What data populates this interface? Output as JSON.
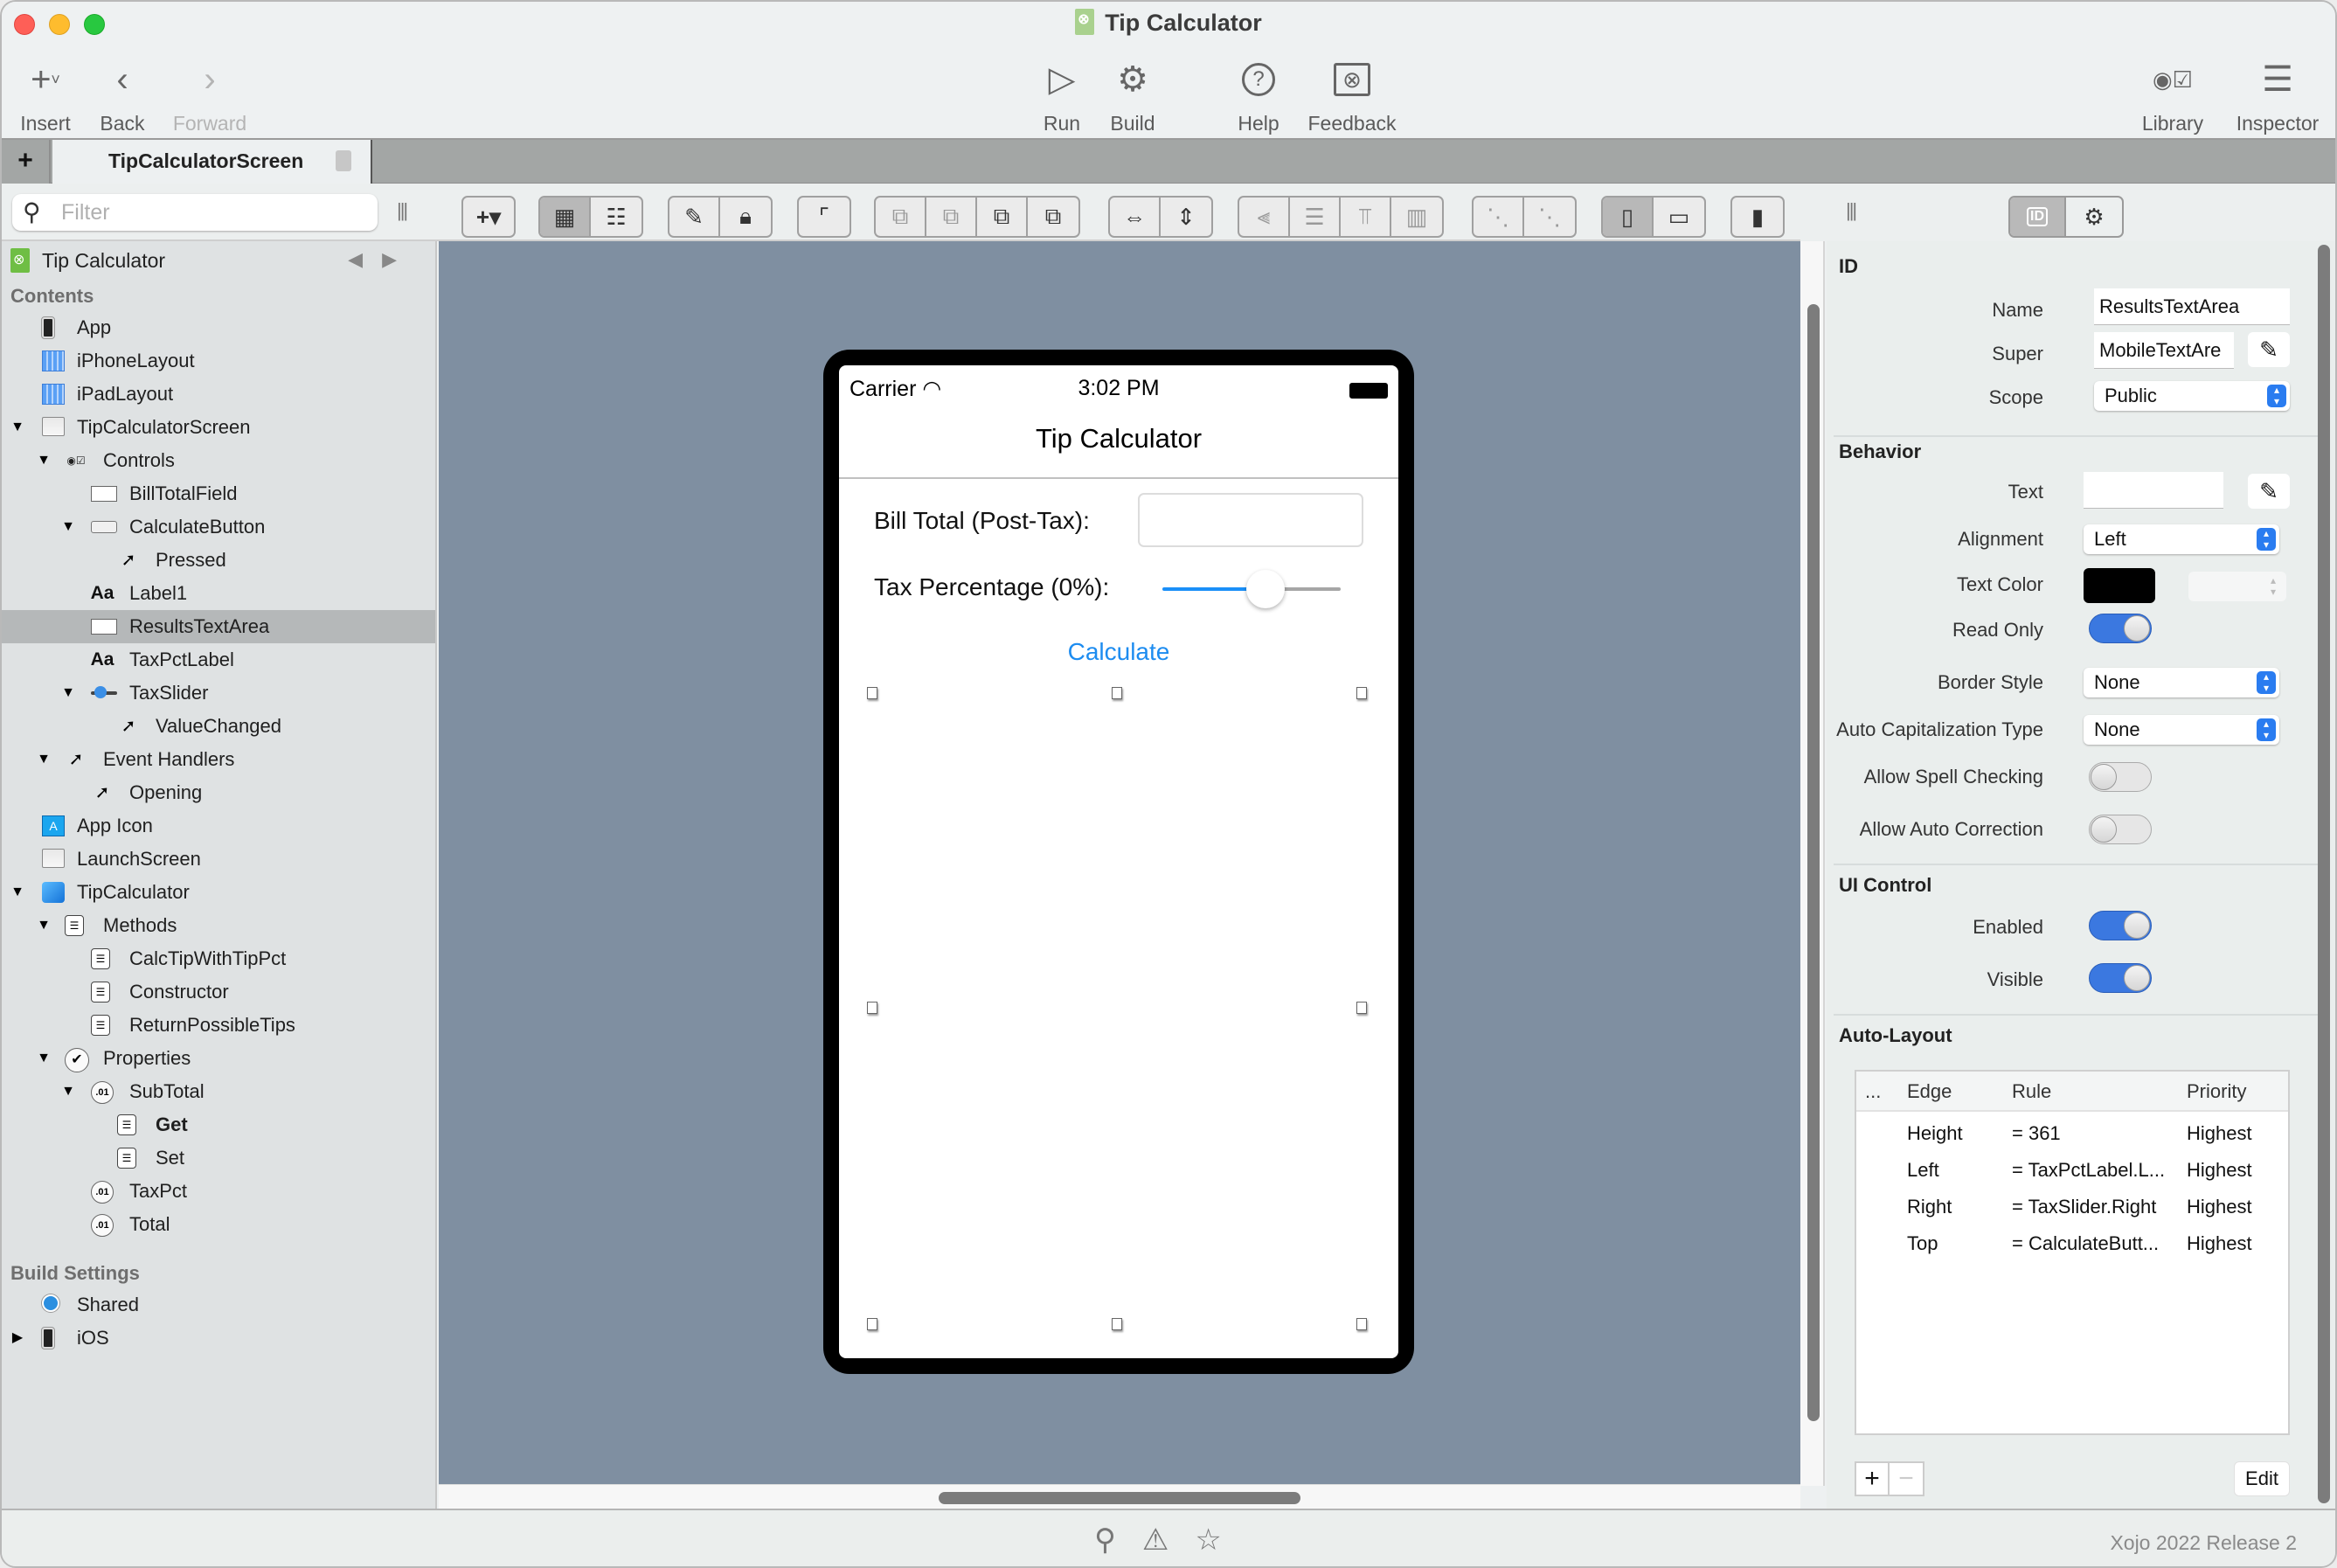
{
  "window": {
    "title": "Tip Calculator",
    "toolbar": {
      "insert": "Insert",
      "back": "Back",
      "forward": "Forward",
      "run": "Run",
      "build": "Build",
      "help": "Help",
      "feedback": "Feedback",
      "library": "Library",
      "inspector": "Inspector"
    }
  },
  "tabs": [
    {
      "label": "TipCalculatorScreen",
      "locked": false
    }
  ],
  "filter": {
    "placeholder": "Filter"
  },
  "navigator": {
    "project": "Tip Calculator",
    "contents_header": "Contents",
    "build_header": "Build Settings",
    "items": [
      {
        "label": "App",
        "icon": "phone-icon",
        "level": 1,
        "expander": ""
      },
      {
        "label": "iPhoneLayout",
        "icon": "layout-grid-icon",
        "level": 1,
        "expander": ""
      },
      {
        "label": "iPadLayout",
        "icon": "layout-grid-icon",
        "level": 1,
        "expander": ""
      },
      {
        "label": "TipCalculatorScreen",
        "icon": "screen-window-icon",
        "level": 1,
        "expander": "▼"
      },
      {
        "label": "Controls",
        "icon": "controls-icon",
        "level": 2,
        "expander": "▼"
      },
      {
        "label": "BillTotalField",
        "icon": "text-field-icon",
        "level": 3,
        "expander": ""
      },
      {
        "label": "CalculateButton",
        "icon": "button-icon",
        "level": 3,
        "expander": "▼"
      },
      {
        "label": "Pressed",
        "icon": "event-icon",
        "level": 4,
        "expander": ""
      },
      {
        "label": "Label1",
        "icon": "label-icon",
        "level": 3,
        "expander": ""
      },
      {
        "label": "ResultsTextArea",
        "icon": "text-area-icon",
        "level": 3,
        "expander": "",
        "selected": true
      },
      {
        "label": "TaxPctLabel",
        "icon": "label-icon",
        "level": 3,
        "expander": ""
      },
      {
        "label": "TaxSlider",
        "icon": "slider-icon",
        "level": 3,
        "expander": "▼"
      },
      {
        "label": "ValueChanged",
        "icon": "event-icon",
        "level": 4,
        "expander": ""
      },
      {
        "label": "Event Handlers",
        "icon": "event-icon",
        "level": 2,
        "expander": "▼"
      },
      {
        "label": "Opening",
        "icon": "event-icon",
        "level": 3,
        "expander": ""
      },
      {
        "label": "App Icon",
        "icon": "app-icon-icon",
        "level": 1,
        "expander": ""
      },
      {
        "label": "LaunchScreen",
        "icon": "screen-window-icon",
        "level": 1,
        "expander": ""
      },
      {
        "label": "TipCalculator",
        "icon": "class-cube-icon",
        "level": 1,
        "expander": "▼"
      },
      {
        "label": "Methods",
        "icon": "method-icon",
        "level": 2,
        "expander": "▼"
      },
      {
        "label": "CalcTipWithTipPct",
        "icon": "method-icon",
        "level": 3,
        "expander": ""
      },
      {
        "label": "Constructor",
        "icon": "method-icon",
        "level": 3,
        "expander": ""
      },
      {
        "label": "ReturnPossibleTips",
        "icon": "method-icon",
        "level": 3,
        "expander": ""
      },
      {
        "label": "Properties",
        "icon": "properties-check-icon",
        "level": 2,
        "expander": "▼"
      },
      {
        "label": "SubTotal",
        "icon": "property-icon",
        "level": 3,
        "expander": "▼"
      },
      {
        "label": "Get",
        "icon": "method-icon",
        "level": 4,
        "expander": "",
        "bold": true
      },
      {
        "label": "Set",
        "icon": "method-icon",
        "level": 4,
        "expander": ""
      },
      {
        "label": "TaxPct",
        "icon": "property-icon",
        "level": 3,
        "expander": ""
      },
      {
        "label": "Total",
        "icon": "property-icon",
        "level": 3,
        "expander": ""
      }
    ],
    "build_items": [
      {
        "label": "Shared",
        "icon": "shared-radio-icon",
        "level": 1,
        "expander": ""
      },
      {
        "label": "iOS",
        "icon": "phone-icon",
        "level": 1,
        "expander": "▶"
      }
    ]
  },
  "phone": {
    "carrier": "Carrier",
    "time": "3:02 PM",
    "nav_title": "Tip Calculator",
    "bill_label": "Bill Total (Post-Tax):",
    "bill_value": "",
    "tax_label": "Tax Percentage (0%):",
    "slider_fraction": 0.58,
    "calculate": "Calculate"
  },
  "inspector": {
    "id_header": "ID",
    "name_label": "Name",
    "name_value": "ResultsTextArea",
    "super_label": "Super",
    "super_value": "MobileTextAre",
    "scope_label": "Scope",
    "scope_value": "Public",
    "behavior_header": "Behavior",
    "text_label": "Text",
    "text_value": "",
    "alignment_label": "Alignment",
    "alignment_value": "Left",
    "textcolor_label": "Text Color",
    "textcolor_value": "#000000",
    "readonly_label": "Read Only",
    "readonly": true,
    "border_label": "Border Style",
    "border_value": "None",
    "autocap_label": "Auto Capitalization Type",
    "autocap_value": "None",
    "spell_label": "Allow Spell Checking",
    "spell": false,
    "autocorrect_label": "Allow Auto Correction",
    "autocorrect": false,
    "uicontrol_header": "UI Control",
    "enabled_label": "Enabled",
    "enabled": true,
    "visible_label": "Visible",
    "visible": true,
    "autolayout_header": "Auto-Layout",
    "columns": [
      "...",
      "Edge",
      "Rule",
      "Priority"
    ],
    "rules": [
      {
        "edge": "Height",
        "rule": "=  361",
        "priority": "Highest"
      },
      {
        "edge": "Left",
        "rule": "= TaxPctLabel.L...",
        "priority": "Highest"
      },
      {
        "edge": "Right",
        "rule": "= TaxSlider.Right",
        "priority": "Highest"
      },
      {
        "edge": "Top",
        "rule": "= CalculateButt...",
        "priority": "Highest"
      }
    ],
    "edit": "Edit"
  },
  "statusbar": {
    "version": "Xojo 2022 Release 2"
  }
}
